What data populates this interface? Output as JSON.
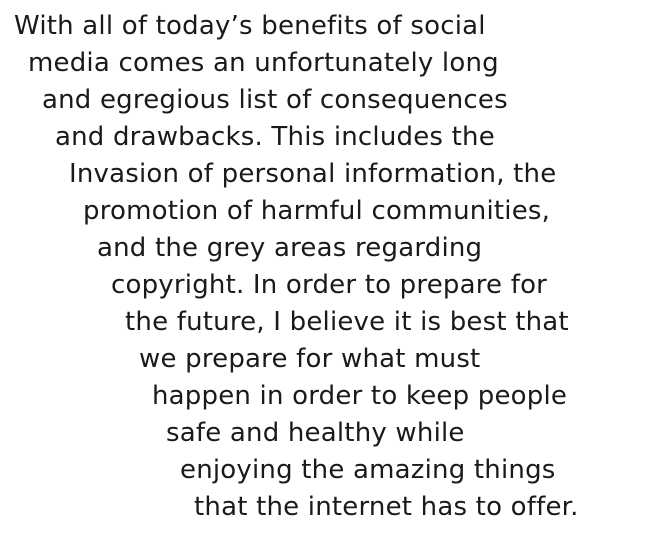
{
  "paragraph": {
    "lines": [
      "With all of today’s benefits of social",
      "media comes an unfortunately long",
      "and egregious list of consequences",
      "and drawbacks. This includes the",
      "Invasion of personal information, the",
      "promotion of harmful communities,",
      "and the grey areas regarding",
      "copyright. In order to prepare for",
      "the future, I believe it is best that",
      "we prepare for what must",
      "happen in order to keep people",
      "safe and healthy while",
      "enjoying the amazing things",
      "that the internet has to offer."
    ]
  }
}
